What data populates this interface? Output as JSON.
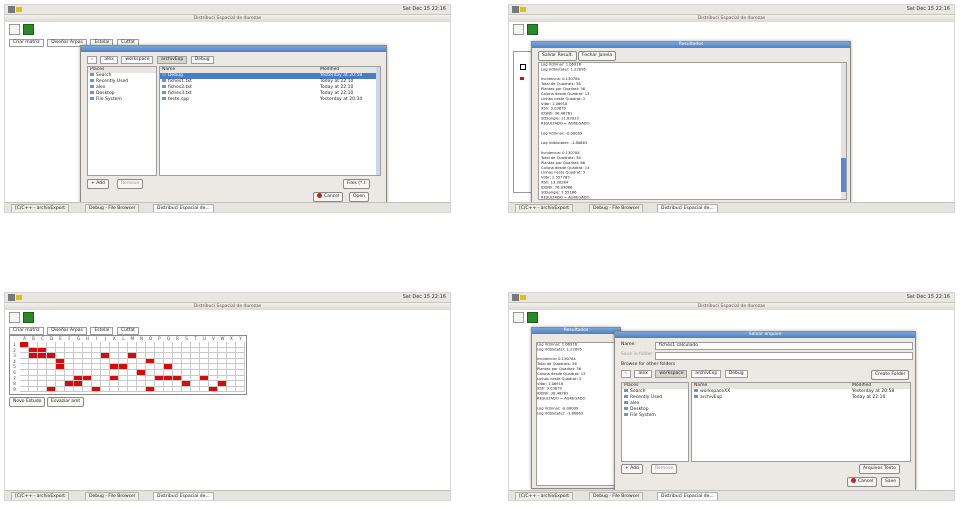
{
  "clock": "Sat Dec 15 22:16",
  "window_title": "Distribuci Espacial de durezas",
  "chip_labels": [
    "Criar matriz",
    "Diseñar Arpas",
    "Estelal",
    "Cutfat"
  ],
  "taskbar": [
    "[C/C++ - archivExport",
    "Debug - File Browser",
    "Distribuci Espacial de..."
  ],
  "colors": {
    "red": "#d60c0c",
    "selection": "#4a7dc8",
    "green": "#2a8a2a"
  },
  "tl": {
    "path": [
      "alex",
      "workspace",
      "archivExp",
      "Debug"
    ],
    "places_header": "Places",
    "places": [
      "Search",
      "Recently Used",
      "alex",
      "Desktop",
      "File System"
    ],
    "name_header": "Name",
    "modified_header": "Modified",
    "files": [
      {
        "name": "Debug",
        "modified": "Yesterday at 20:58",
        "sel": true
      },
      {
        "name": "fiches1.txt",
        "modified": "Today at 22:10"
      },
      {
        "name": "fiches2.txt",
        "modified": "Today at 22:10"
      },
      {
        "name": "fiches3.txt",
        "modified": "Today at 22:10"
      },
      {
        "name": "teste.cpp",
        "modified": "Yesterday at 20:34"
      }
    ],
    "add": "Add",
    "remove": "Remove",
    "filter": "Files (*.t",
    "cancel": "Cancel",
    "open": "Open"
  },
  "tr": {
    "dialog_title": "Resultados",
    "btn1": "Salvar Result.",
    "btn2": "Fechar Janela",
    "lines": [
      "Log Vdmnar: 1.06918",
      "Log Vdbiutater: 1.22895",
      "",
      "Incidencia: 0.130784",
      "Total de Quadrats: 36",
      "Plantas por Quadrat: 36",
      "Coluna desde Quadrat: 13",
      "Linhas neste Quadrat: 2",
      "Vdbr: 1.06918",
      "Xbh: 9.03679",
      "IDSNh: 38.48761",
      "SDSangle: 11.83023",
      "RESULTADO = AGREGADO",
      "",
      "Log Vdmnar: -0.00009",
      "",
      "Log Vdbiutater: -1.80663",
      "",
      "Incidencia: 0.130784",
      "Total de Quadrats: 36",
      "Plantas por Quadrat: 66",
      "Coluna desde Quadrat: 14",
      "Linhas neste Quadrat: 5",
      "Vdbr: 2.557785",
      "Xbh: 13.30284",
      "IDSNh: 76.09686",
      "SDSangle: 7.55166",
      "RESULTADO = AGREGADO",
      "",
      "Log Vdmnar: 2.70375",
      "",
      "Log Vdbiutater: -1.91203"
    ]
  },
  "bl": {
    "cols": [
      "A",
      "B",
      "C",
      "D",
      "E",
      "F",
      "G",
      "H",
      "I",
      "J",
      "K",
      "L",
      "M",
      "N",
      "O",
      "P",
      "Q",
      "R",
      "S",
      "T",
      "U",
      "V",
      "W",
      "X",
      "Y"
    ],
    "rows": [
      "1",
      "2",
      "3",
      "4",
      "5",
      "6",
      "7",
      "8",
      "9"
    ],
    "cells": [
      [
        0,
        0
      ],
      [
        1,
        1
      ],
      [
        2,
        1
      ],
      [
        1,
        2
      ],
      [
        2,
        2
      ],
      [
        3,
        2
      ],
      [
        4,
        3
      ],
      [
        4,
        4
      ],
      [
        9,
        2
      ],
      [
        12,
        2
      ],
      [
        10,
        4
      ],
      [
        11,
        4
      ],
      [
        13,
        5
      ],
      [
        14,
        3
      ],
      [
        16,
        4
      ],
      [
        6,
        6
      ],
      [
        7,
        6
      ],
      [
        10,
        6
      ],
      [
        5,
        7
      ],
      [
        6,
        7
      ],
      [
        15,
        6
      ],
      [
        16,
        6
      ],
      [
        17,
        6
      ],
      [
        20,
        6
      ],
      [
        21,
        8
      ],
      [
        8,
        8
      ],
      [
        3,
        8
      ],
      [
        14,
        8
      ],
      [
        18,
        7
      ],
      [
        22,
        7
      ]
    ],
    "btn1": "Novo Estudo",
    "btn2": "Esvaziar amt"
  },
  "br": {
    "dialog_title": "Salvar arquivo",
    "under_title": "Resultados",
    "name_label": "Name:",
    "name_value": "fiches1 calculado",
    "save_in_label": "Save in folder:",
    "browse": "Browse for other folders",
    "path": [
      "alex",
      "workspace",
      "archivExp",
      "Debug"
    ],
    "create_folder": "Create Folder",
    "places_header": "Places",
    "places": [
      "Search",
      "Recently Used",
      "alex",
      "Desktop",
      "File System"
    ],
    "name_header": "Name",
    "modified_header": "Modified",
    "files": [
      {
        "name": "workspaceXX",
        "modified": "Yesterday at 20:58"
      },
      {
        "name": "archivExp",
        "modified": "Today at 22:10"
      }
    ],
    "bg_lines": [
      "Log Vdmnar: 1.06918",
      "Log Vdbiutater: 1.22895",
      "",
      "Incidencia: 0.130784",
      "Total de Quadrats: 36",
      "Plantas por Quadrat: 36",
      "Coluna desde Quadrat: 13",
      "Linhas neste Quadrat: 2",
      "Vdbr: 1.06918",
      "Xbh: 9.03679",
      "IDSNh: 38.48761",
      "RESULTADO = AGREGADO",
      "",
      "Log Vdmnar: -0.00009",
      "Log Vdbiutater: -1.80663"
    ],
    "add": "Add",
    "remove": "Remove",
    "filter": "Arquivos Texto",
    "cancel": "Cancel",
    "save": "Save"
  }
}
